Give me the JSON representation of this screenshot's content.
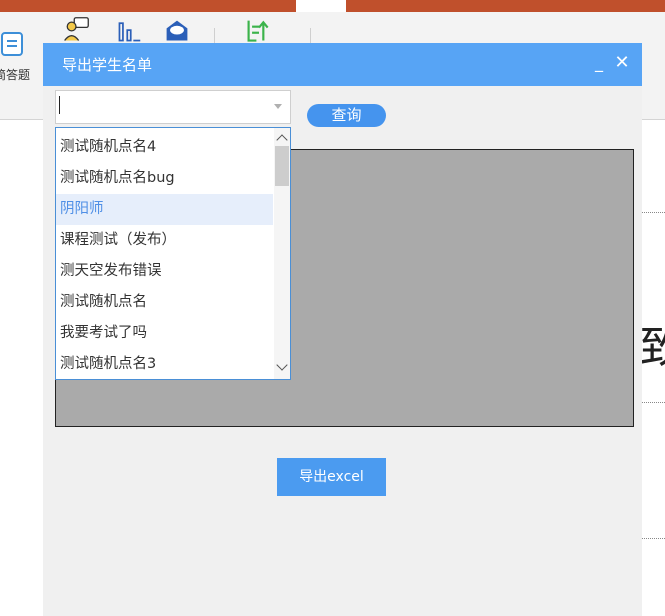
{
  "background": {
    "ribbon_label": "简答题",
    "big_char": "致"
  },
  "dialog": {
    "title": "导出学生名单",
    "minimize_label": "_",
    "close_label": "✕"
  },
  "combo": {
    "value": ""
  },
  "query_button": "查询",
  "dropdown": {
    "items": [
      "测试随机点名4",
      "测试随机点名bug",
      "阴阳师",
      "课程测试（发布）",
      "测天空发布错误",
      "测试随机点名",
      "我要考试了吗",
      "测试随机点名3"
    ],
    "selected_index": 2
  },
  "export_button": "导出excel",
  "colors": {
    "titlebar": "#57a4f5",
    "query_button": "#4594ee",
    "export_button": "#4b9bf0",
    "selected_text": "#4f8fe6",
    "grid_background": "#aaaaaa"
  }
}
